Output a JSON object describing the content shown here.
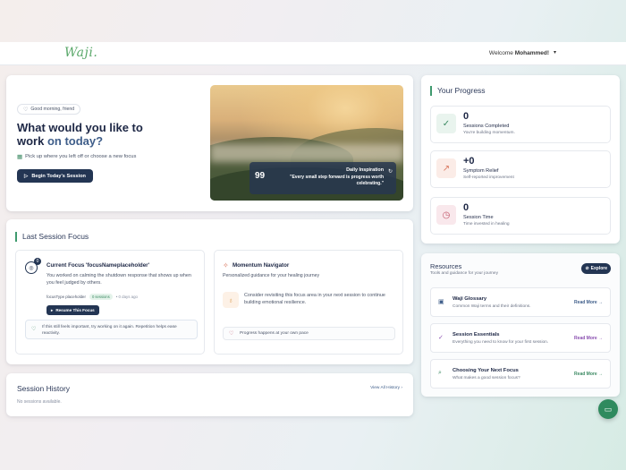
{
  "header": {
    "logo": "Waji.",
    "welcome_prefix": "Welcome",
    "user_name": "Mohammed!",
    "caret": "▾"
  },
  "hero": {
    "greeting": "Good morning, friend",
    "title_line1": "What would you like to",
    "title_line2_a": "work",
    "title_line2_b": "on today?",
    "subtitle": "Pick up where you left off or choose a new focus",
    "begin_button": "Begin Today's Session",
    "inspiration_label": "Daily Inspiration",
    "inspiration_quote": "\"Every small step forward is progress worth celebrating.\""
  },
  "progress": {
    "title": "Your Progress",
    "stats": [
      {
        "value": "0",
        "label": "Sessions Completed",
        "sub": "You're building momentum.",
        "icon": "check-circle-icon",
        "color": "#3c8a63",
        "bg": "#e9f4ee",
        "glyph": "✓"
      },
      {
        "value": "+0",
        "label": "Symptom Relief",
        "sub": "Self-reported improvement",
        "icon": "trend-up-icon",
        "color": "#d9775e",
        "bg": "#fbece7",
        "glyph": "↗"
      },
      {
        "value": "0",
        "label": "Session Time",
        "sub": "Time invested in healing",
        "icon": "clock-icon",
        "color": "#c2566a",
        "bg": "#f9e8ec",
        "glyph": "◷"
      }
    ]
  },
  "last_session": {
    "title": "Last Session Focus",
    "focus": {
      "badge": "0",
      "title": "Current Focus 'focusNameplaceholder'",
      "body": "You worked on calming the shutdown response that shows up when you feel judged by others.",
      "type": "focusType placeholder",
      "sessions": "0 sessions",
      "ago": "• 0 days ago",
      "resume_button": "Resume This Focus",
      "tip": "If this still feels important, try working on it again. Repetition helps ease reactivity."
    },
    "navigator": {
      "title": "Momentum Navigator",
      "sub": "Personalized guidance for your healing journey",
      "advice": "Consider revisiting this focus area in your next session to continue building emotional resilience.",
      "footer": "Progress happens at your own pace"
    }
  },
  "history": {
    "title": "Session History",
    "view_all": "View All History",
    "empty": "No sessions available."
  },
  "resources": {
    "title": "Resources",
    "sub": "Tools and guidance for your journey",
    "explore": "Explore",
    "items": [
      {
        "title": "Waji Glossary",
        "desc": "Common Waji terms and their definitions.",
        "link": "Read More",
        "color": "#3f5e8a",
        "glyph": "▣"
      },
      {
        "title": "Session Essentials",
        "desc": "Everything you need to know for your first session.",
        "link": "Read More",
        "color": "#8a4fb0",
        "glyph": "✓"
      },
      {
        "title": "Choosing Your Next Focus",
        "desc": "What makes a good session focus?",
        "link": "Read More",
        "color": "#3c8a63",
        "glyph": "⌕"
      }
    ]
  }
}
